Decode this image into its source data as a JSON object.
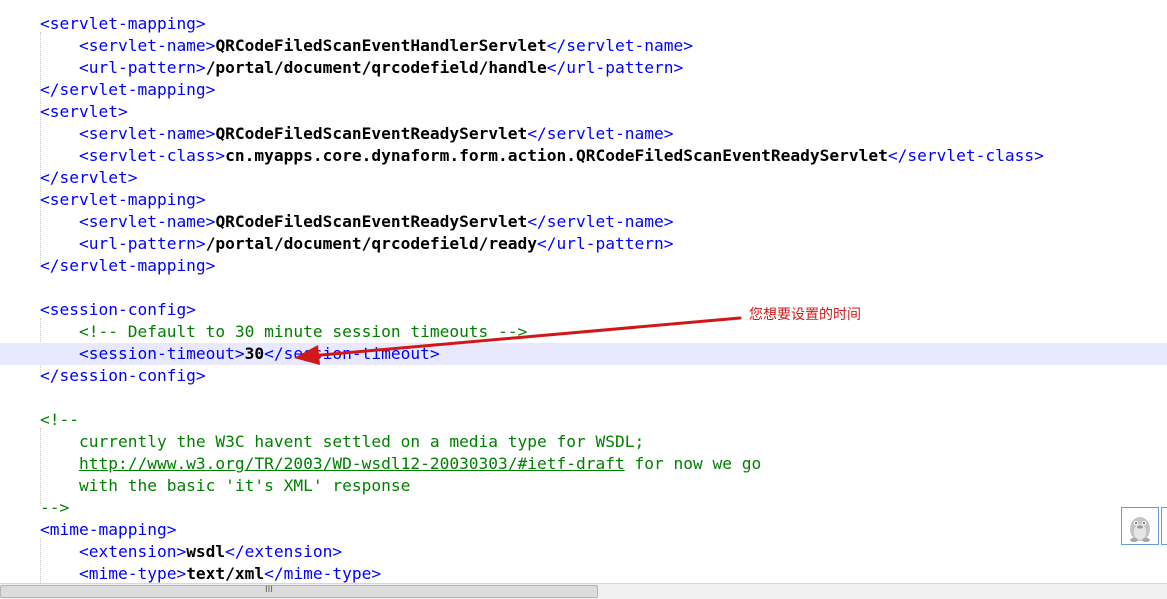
{
  "code_lines": [
    [
      {
        "c": "tag",
        "t": "<servlet-mapping>"
      }
    ],
    [
      {
        "c": "tag",
        "t": "    <servlet-name>"
      },
      {
        "c": "txt",
        "t": "QRCodeFiledScanEventHandlerServlet"
      },
      {
        "c": "tag",
        "t": "</servlet-name>"
      }
    ],
    [
      {
        "c": "tag",
        "t": "    <url-pattern>"
      },
      {
        "c": "txt",
        "t": "/portal/document/qrcodefield/handle"
      },
      {
        "c": "tag",
        "t": "</url-pattern>"
      }
    ],
    [
      {
        "c": "tag",
        "t": "</servlet-mapping>"
      }
    ],
    [
      {
        "c": "tag",
        "t": "<servlet>"
      }
    ],
    [
      {
        "c": "tag",
        "t": "    <servlet-name>"
      },
      {
        "c": "txt",
        "t": "QRCodeFiledScanEventReadyServlet"
      },
      {
        "c": "tag",
        "t": "</servlet-name>"
      }
    ],
    [
      {
        "c": "tag",
        "t": "    <servlet-class>"
      },
      {
        "c": "txt",
        "t": "cn.myapps.core.dynaform.form.action.QRCodeFiledScanEventReadyServlet"
      },
      {
        "c": "tag",
        "t": "</servlet-class>"
      }
    ],
    [
      {
        "c": "tag",
        "t": "</servlet>"
      }
    ],
    [
      {
        "c": "tag",
        "t": "<servlet-mapping>"
      }
    ],
    [
      {
        "c": "tag",
        "t": "    <servlet-name>"
      },
      {
        "c": "txt",
        "t": "QRCodeFiledScanEventReadyServlet"
      },
      {
        "c": "tag",
        "t": "</servlet-name>"
      }
    ],
    [
      {
        "c": "tag",
        "t": "    <url-pattern>"
      },
      {
        "c": "txt",
        "t": "/portal/document/qrcodefield/ready"
      },
      {
        "c": "tag",
        "t": "</url-pattern>"
      }
    ],
    [
      {
        "c": "tag",
        "t": "</servlet-mapping>"
      }
    ],
    [],
    [
      {
        "c": "tag",
        "t": "<session-config>"
      }
    ],
    [
      {
        "c": "cmt",
        "t": "    <!-- Default to 30 minute session timeouts -->"
      }
    ],
    [
      {
        "c": "tag",
        "t": "    <session-timeout>"
      },
      {
        "c": "txt",
        "t": "30"
      },
      {
        "c": "tag",
        "t": "</session-timeout>"
      }
    ],
    [
      {
        "c": "tag",
        "t": "</session-config>"
      }
    ],
    [],
    [
      {
        "c": "cmt",
        "t": "<!--"
      }
    ],
    [
      {
        "c": "cmt",
        "t": "    currently the W3C havent settled on a media type for WSDL;"
      }
    ],
    [
      {
        "c": "cmt",
        "t": "    "
      },
      {
        "c": "lnk",
        "t": "http://www.w3.org/TR/2003/WD-wsdl12-20030303/#ietf-draft"
      },
      {
        "c": "cmt",
        "t": " for now we go"
      }
    ],
    [
      {
        "c": "cmt",
        "t": "    with the basic 'it's XML' response"
      }
    ],
    [
      {
        "c": "cmt",
        "t": "-->"
      }
    ],
    [
      {
        "c": "tag",
        "t": "<mime-mapping>"
      }
    ],
    [
      {
        "c": "tag",
        "t": "    <extension>"
      },
      {
        "c": "txt",
        "t": "wsdl"
      },
      {
        "c": "tag",
        "t": "</extension>"
      }
    ],
    [
      {
        "c": "tag",
        "t": "    <mime-type>"
      },
      {
        "c": "txt",
        "t": "text/xml"
      },
      {
        "c": "tag",
        "t": "</mime-type>"
      }
    ]
  ],
  "highlighted_line": 15,
  "annotation": {
    "text": "您想要设置的时间",
    "color": "#d01818"
  },
  "scrollbar": {
    "grip": "III",
    "thumb_fraction": 0.51
  },
  "widget": {
    "icon": "qq-penguin-icon"
  },
  "colors": {
    "tag": "#0000ff",
    "text": "#000000",
    "comment": "#008000",
    "line_highlight": "#e8e8ff",
    "annotation": "#d01818"
  }
}
